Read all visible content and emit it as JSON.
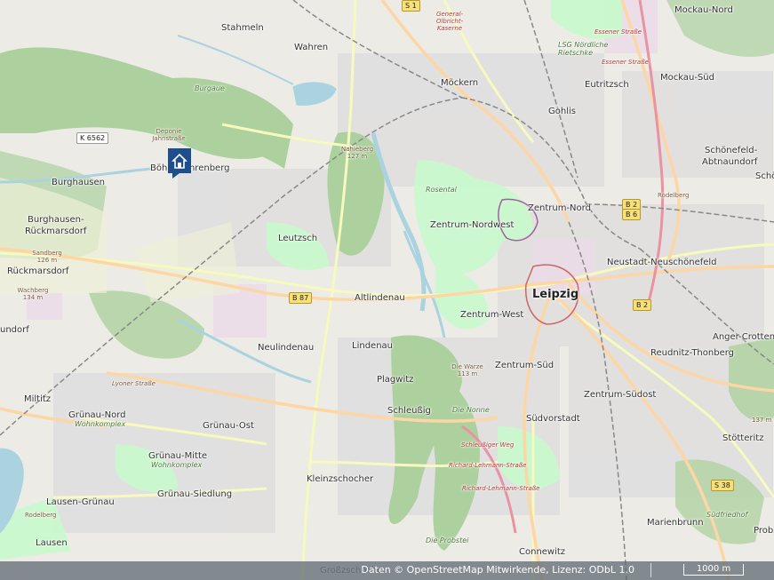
{
  "map": {
    "districts": [
      {
        "name": "Stahmeln"
      },
      {
        "name": "Wahren"
      },
      {
        "name": "Möckern"
      },
      {
        "name": "Eutritzsch"
      },
      {
        "name": "Mockau-Nord"
      },
      {
        "name": "Mockau-Süd"
      },
      {
        "name": "Gohlis"
      },
      {
        "name": "Schönefeld-"
      },
      {
        "name": "Abtnaundorf"
      },
      {
        "name": "Böhlitz-Ehrenberg"
      },
      {
        "name": "Burghausen"
      },
      {
        "name": "Burghausen-"
      },
      {
        "name": "Rückmarsdorf"
      },
      {
        "name": "Rückmarsdorf"
      },
      {
        "name": "Zentrum-Nord"
      },
      {
        "name": "Zentrum-Nordwest"
      },
      {
        "name": "Leutzsch"
      },
      {
        "name": "Neustadt-Neuschönefeld"
      },
      {
        "name": "Altlindenau"
      },
      {
        "name": "Leipzig"
      },
      {
        "name": "Zentrum-West"
      },
      {
        "name": "Neulindenau"
      },
      {
        "name": "Lindenau"
      },
      {
        "name": "Anger-Crottendorf"
      },
      {
        "name": "Reudnitz-Thonberg"
      },
      {
        "name": "Plagwitz"
      },
      {
        "name": "Zentrum-Süd"
      },
      {
        "name": "Zentrum-Südost"
      },
      {
        "name": "Miltitz"
      },
      {
        "name": "Grünau-Nord"
      },
      {
        "name": "Schleußig"
      },
      {
        "name": "Südvorstadt"
      },
      {
        "name": "Grünau-Ost"
      },
      {
        "name": "Stötteritz"
      },
      {
        "name": "Grünau-Mitte"
      },
      {
        "name": "Kleinzschocher"
      },
      {
        "name": "Grünau-Siedlung"
      },
      {
        "name": "Lausen-Grünau"
      },
      {
        "name": "Marienbrunn"
      },
      {
        "name": "Lausen"
      },
      {
        "name": "Connewitz"
      },
      {
        "name": "undorf"
      },
      {
        "name": "Schö"
      },
      {
        "name": "Probs"
      },
      {
        "name": "Rodelberg"
      },
      {
        "name": "Großzschocher"
      }
    ],
    "parks": [
      {
        "name": "Burgaue"
      },
      {
        "name": "Rosental"
      },
      {
        "name": "Die Nonne"
      },
      {
        "name": "Die Probstei"
      },
      {
        "name": "Wohnkomplex"
      },
      {
        "name": "Wohnkomplex"
      },
      {
        "name": "LSG Nördliche Rietschke"
      },
      {
        "name": "Rodelberg"
      }
    ],
    "streets": [
      {
        "name": "Essener Straße"
      },
      {
        "name": "Essener Straße"
      },
      {
        "name": "Schleußiger Weg"
      },
      {
        "name": "Richard-Lehmann-Straße"
      },
      {
        "name": "Richard-Lehmann-Straße"
      },
      {
        "name": "Lyoner Straße"
      },
      {
        "name": "Südfriedhof"
      },
      {
        "name": "General-Olbricht-Kaserne"
      },
      {
        "name": "Deponie Jahnstraße"
      }
    ],
    "peaks": [
      {
        "name": "Nahleberg 127 m"
      },
      {
        "name": "Sandberg 126 m"
      },
      {
        "name": "Wachberg 134 m"
      },
      {
        "name": "Die Warze 113 m"
      },
      {
        "name": "137 m"
      }
    ],
    "shields": [
      {
        "ref": "K 6562"
      },
      {
        "ref": "B 87"
      },
      {
        "ref": "B 2"
      },
      {
        "ref": "B 6"
      },
      {
        "ref": "B 2"
      },
      {
        "ref": "S 38"
      },
      {
        "ref": "S 1"
      }
    ]
  },
  "footer": {
    "attribution": "Daten © OpenStreetMap Mitwirkende, Lizenz: ODbL 1.0",
    "scale_label": "1000 m"
  },
  "marker": {
    "icon": "home-icon",
    "color": "#1f4e8c"
  },
  "colors": {
    "base": "#f2efe9",
    "forest": "#add19e",
    "park": "#c8facc",
    "water": "#aad3df",
    "residential": "#e0dfdf",
    "primary": "#fcd6a4",
    "secondary": "#f7fabf",
    "motorway": "#e892a2",
    "rail": "#888888"
  }
}
